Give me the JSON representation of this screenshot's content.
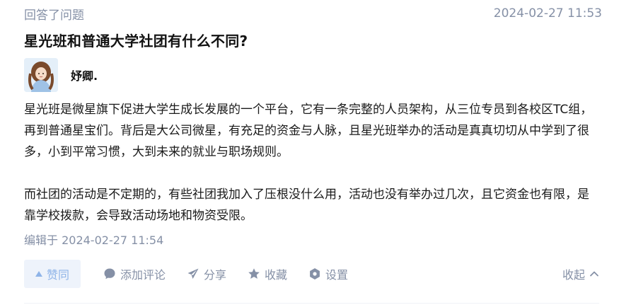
{
  "header": {
    "activity": "回答了问题",
    "timestamp": "2024-02-27 11:53"
  },
  "question": {
    "title": "星光班和普通大学社团有什么不同?"
  },
  "author": {
    "name": "妤卿."
  },
  "answer": {
    "paragraphs": [
      "星光班是微星旗下促进大学生成长发展的一个平台，它有一条完整的人员架构，从三位专员到各校区TC组，再到普通星宝们。背后是大公司微星，有充足的资金与人脉，且星光班举办的活动是真真切切从中学到了很多，小到平常习惯，大到未来的就业与职场规则。",
      "而社团的活动是不定期的，有些社团我加入了压根没什么用，活动也没有举办过几次，且它资金也有限，是靠学校拨款，会导致活动场地和物资受限。"
    ],
    "edited": "编辑于 2024-02-27 11:54"
  },
  "actions": {
    "vote_label": "赞同",
    "comment_label": "添加评论",
    "share_label": "分享",
    "favorite_label": "收藏",
    "settings_label": "设置",
    "collapse_label": "收起"
  },
  "icons": {
    "vote": "upvote-triangle-icon",
    "comment": "comment-bubble-icon",
    "share": "share-plane-icon",
    "favorite": "star-icon",
    "settings": "gear-icon",
    "collapse": "chevron-up-icon"
  },
  "colors": {
    "muted_text": "#8590a6",
    "vote_bg": "#eef3fb",
    "vote_text": "#8fb4e8"
  }
}
